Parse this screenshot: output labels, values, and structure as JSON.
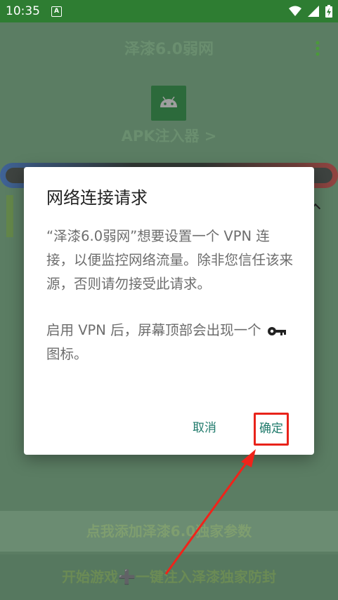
{
  "status_bar": {
    "time": "10:35",
    "notification_icon": "A"
  },
  "app": {
    "title": "泽漆6.0弱网",
    "apk_label": "APK注入器 >",
    "bottom_button_1": "点我添加泽漆6.0独家参数",
    "bottom_button_2_left": "开始游戏",
    "bottom_button_2_plus": "➕",
    "bottom_button_2_right": "一键注入泽漆独家防封"
  },
  "dialog": {
    "title": "网络连接请求",
    "body_1": "“泽漆6.0弱网”想要设置一个 VPN 连接，以便监控网络流量。除非您信任该来源，否则请勿接受此请求。",
    "body_2_prefix": "启用 VPN 后，屏幕顶部会出现一个",
    "body_2_suffix": "图标。",
    "cancel_label": "取消",
    "ok_label": "确定"
  },
  "colors": {
    "status_bar": "#2e7d32",
    "accent": "#1f7a6b",
    "highlight": "#e8231a"
  }
}
